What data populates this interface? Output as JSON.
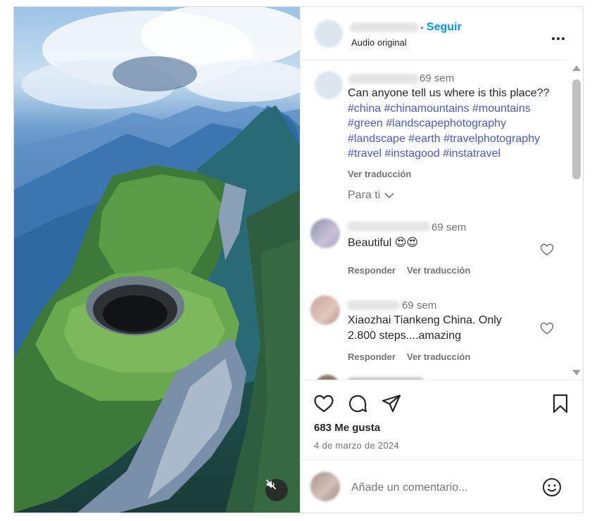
{
  "post": {
    "header": {
      "follow_separator": "•",
      "follow_label": "Seguir",
      "audio_label": "Audio original"
    },
    "caption": {
      "time": "69 sem",
      "text": "Can anyone tell us where is this place??",
      "hashtags_line1": "#china #chinamountains #mountains",
      "hashtags_line2": "#green #landscapephotography",
      "hashtags_line3": "#landscape #earth #travelphotography",
      "hashtags_line4": "#travel #instagood #instatravel",
      "translate_label": "Ver traducción"
    },
    "para_ti": "Para ti",
    "comments": [
      {
        "time": "69 sem",
        "text": "Beautiful 😍😍",
        "reply_label": "Responder",
        "translate_label": "Ver traducción"
      },
      {
        "time": "69 sem",
        "text_line1": "Xiaozhai Tiankeng China. Only",
        "text_line2": "2.800 steps....amazing",
        "reply_label": "Responder",
        "translate_label": "Ver traducción"
      }
    ],
    "likes": "683 Me gusta",
    "date": "4 de marzo de 2024",
    "add_comment_placeholder": "Añade un comentario..."
  },
  "icons": {
    "mute": "speaker-muted-icon",
    "more": "more-options-icon",
    "like": "heart-icon",
    "comment": "comment-bubble-icon",
    "share": "paper-plane-icon",
    "save": "bookmark-icon",
    "emoji": "smiley-icon",
    "expand": "chevron-down-icon"
  },
  "colors": {
    "accent": "#0095f6",
    "hashtag": "#4a5bc4",
    "muted_text": "#737373"
  }
}
